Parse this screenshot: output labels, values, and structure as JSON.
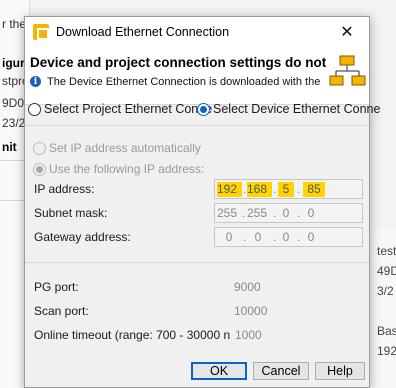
{
  "background": {
    "left_fragments": [
      "r the F",
      "igurat",
      "stpro",
      "9D0",
      "23/2",
      "nit"
    ],
    "right_fragments": [
      "test",
      "49D",
      "3/2",
      "Bas",
      "192"
    ]
  },
  "dialog": {
    "title": "Download Ethernet Connection",
    "close_glyph": "✕",
    "header_title": "Device and project connection settings do not",
    "header_subtitle": "The Device Ethernet Connection is downloaded with the",
    "info_glyph": "i",
    "source_options": [
      {
        "label": "Select Project Ethernet Conne",
        "checked": false
      },
      {
        "label": "Select Device Ethernet Conne",
        "checked": true
      }
    ],
    "ip_mode": {
      "auto_label": "Set IP address automatically",
      "manual_label": "Use the following IP address:",
      "manual_checked": true
    },
    "ip_address": {
      "label": "IP address:",
      "octets": [
        "192",
        "168",
        "5",
        "85"
      ],
      "highlight_color": "#ffd400"
    },
    "subnet_mask": {
      "label": "Subnet mask:",
      "octets": [
        "255",
        "255",
        "0",
        "0"
      ]
    },
    "gateway": {
      "label": "Gateway address:",
      "octets": [
        "0",
        "0",
        "0",
        "0"
      ]
    },
    "pg_port": {
      "label": "PG port:",
      "value": "9000"
    },
    "scan_port": {
      "label": "Scan port:",
      "value": "10000"
    },
    "online_timeout": {
      "label": "Online timeout (range: 700 - 30000 n",
      "value": "1000"
    },
    "buttons": {
      "ok": "OK",
      "cancel": "Cancel",
      "help": "Help"
    },
    "accent_color": "#0a64c8",
    "icons": {
      "app": "download-app-icon",
      "header": "network-devices-icon"
    }
  }
}
